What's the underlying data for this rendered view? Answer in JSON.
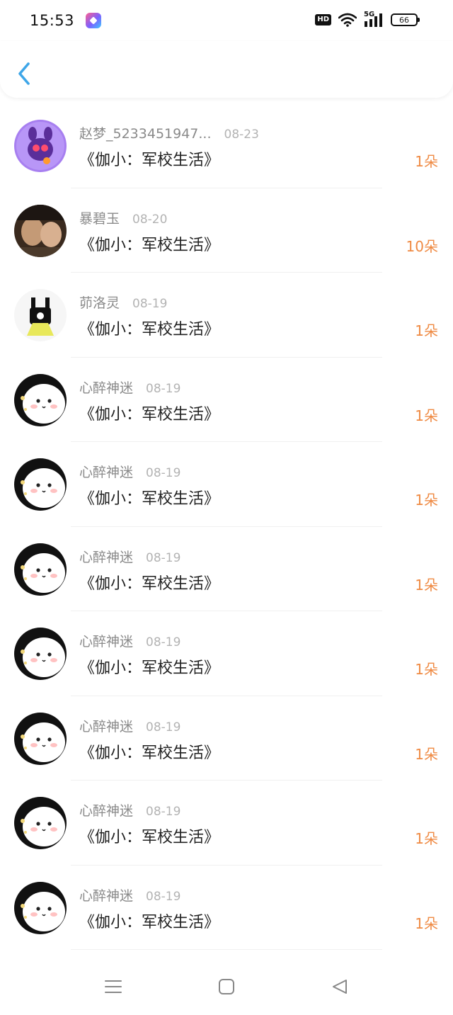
{
  "status_bar": {
    "time": "15:53",
    "hd_label": "HD",
    "signal_label": "5G",
    "battery": "66"
  },
  "header": {
    "back_icon": "chevron-left-icon",
    "accent_color": "#3ea6e8"
  },
  "gift_list": [
    {
      "name": "赵梦_5233451947...",
      "date": "08-23",
      "book": "《伽小：军校生活》",
      "count": "1朵",
      "avatar": "purple-cartoon-avatar"
    },
    {
      "name": "暴碧玉",
      "date": "08-20",
      "book": "《伽小：军校生活》",
      "count": "10朵",
      "avatar": "photo-avatar"
    },
    {
      "name": "茆洛灵",
      "date": "08-19",
      "book": "《伽小：军校生活》",
      "count": "1朵",
      "avatar": "bunny-avatar"
    },
    {
      "name": "心醉神迷",
      "date": "08-19",
      "book": "《伽小：军校生活》",
      "count": "1朵",
      "avatar": "cute-face-avatar"
    },
    {
      "name": "心醉神迷",
      "date": "08-19",
      "book": "《伽小：军校生活》",
      "count": "1朵",
      "avatar": "cute-face-avatar"
    },
    {
      "name": "心醉神迷",
      "date": "08-19",
      "book": "《伽小：军校生活》",
      "count": "1朵",
      "avatar": "cute-face-avatar"
    },
    {
      "name": "心醉神迷",
      "date": "08-19",
      "book": "《伽小：军校生活》",
      "count": "1朵",
      "avatar": "cute-face-avatar"
    },
    {
      "name": "心醉神迷",
      "date": "08-19",
      "book": "《伽小：军校生活》",
      "count": "1朵",
      "avatar": "cute-face-avatar"
    },
    {
      "name": "心醉神迷",
      "date": "08-19",
      "book": "《伽小：军校生活》",
      "count": "1朵",
      "avatar": "cute-face-avatar"
    },
    {
      "name": "心醉神迷",
      "date": "08-19",
      "book": "《伽小：军校生活》",
      "count": "1朵",
      "avatar": "cute-face-avatar"
    }
  ],
  "colors": {
    "count": "#ef8a43",
    "name": "#8a8a8a",
    "date": "#b3b3b3"
  },
  "nav_bar": {
    "menu_icon": "menu-icon",
    "home_icon": "home-square-icon",
    "back_icon": "back-triangle-icon"
  }
}
